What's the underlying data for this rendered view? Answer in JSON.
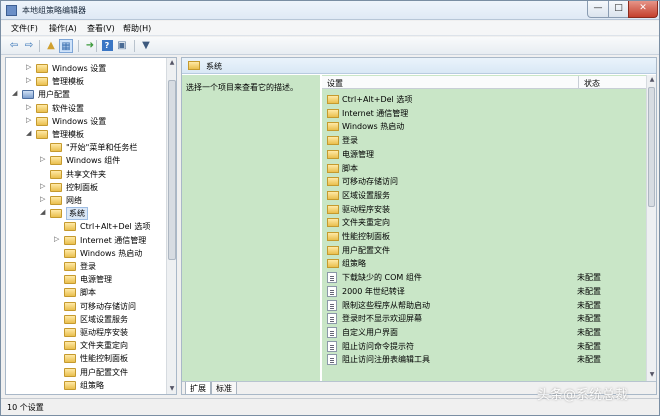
{
  "window": {
    "title": "本地组策略编辑器",
    "controls": {
      "minimize": "—",
      "maximize": "□",
      "close": "✕"
    }
  },
  "menu": [
    {
      "label": "文件(F)"
    },
    {
      "label": "操作(A)"
    },
    {
      "label": "查看(V)"
    },
    {
      "label": "帮助(H)"
    }
  ],
  "toolbar": {
    "icons": [
      "back-arrow-icon",
      "forward-arrow-icon",
      "up-folder-icon",
      "show-tree-icon",
      "export-list-icon",
      "help-icon",
      "properties-icon",
      "filter-icon"
    ],
    "glyphs": {
      "back": "⇦",
      "forward": "⇨",
      "up": "▲",
      "show_tree": "▦",
      "export": "➜",
      "help": "?",
      "properties": "▣",
      "filter": "▼"
    }
  },
  "tree": {
    "toggle_collapsed": "▷",
    "toggle_expanded": "◢",
    "items": [
      {
        "label": "Windows 设置",
        "toggle": "collapsed",
        "icon": "folder"
      },
      {
        "label": "管理模板",
        "toggle": "collapsed",
        "icon": "folder"
      },
      {
        "label": "用户配置",
        "toggle": "expanded",
        "icon": "computer"
      },
      {
        "label": "软件设置",
        "toggle": "collapsed",
        "icon": "folder"
      },
      {
        "label": "Windows 设置",
        "toggle": "collapsed",
        "icon": "folder"
      },
      {
        "label": "管理模板",
        "toggle": "expanded",
        "icon": "folder"
      },
      {
        "label": "\"开始\"菜单和任务栏",
        "toggle": "none",
        "icon": "folder"
      },
      {
        "label": "Windows 组件",
        "toggle": "collapsed",
        "icon": "folder"
      },
      {
        "label": "共享文件夹",
        "toggle": "none",
        "icon": "folder"
      },
      {
        "label": "控制面板",
        "toggle": "collapsed",
        "icon": "folder"
      },
      {
        "label": "网络",
        "toggle": "collapsed",
        "icon": "folder"
      },
      {
        "label": "系统",
        "toggle": "expanded",
        "icon": "folder",
        "selected": true
      },
      {
        "label": "Ctrl+Alt+Del 选项",
        "toggle": "none",
        "icon": "folder"
      },
      {
        "label": "Internet 通信管理",
        "toggle": "collapsed",
        "icon": "folder"
      },
      {
        "label": "Windows 热启动",
        "toggle": "none",
        "icon": "folder"
      },
      {
        "label": "登录",
        "toggle": "none",
        "icon": "folder"
      },
      {
        "label": "电源管理",
        "toggle": "none",
        "icon": "folder"
      },
      {
        "label": "脚本",
        "toggle": "none",
        "icon": "folder"
      },
      {
        "label": "可移动存储访问",
        "toggle": "none",
        "icon": "folder"
      },
      {
        "label": "区域设置服务",
        "toggle": "none",
        "icon": "folder"
      },
      {
        "label": "驱动程序安装",
        "toggle": "none",
        "icon": "folder"
      },
      {
        "label": "文件夹重定向",
        "toggle": "none",
        "icon": "folder"
      },
      {
        "label": "性能控制面板",
        "toggle": "none",
        "icon": "folder"
      },
      {
        "label": "用户配置文件",
        "toggle": "none",
        "icon": "folder"
      },
      {
        "label": "组策略",
        "toggle": "none",
        "icon": "folder"
      }
    ]
  },
  "right": {
    "header_title": "系统",
    "description": "选择一个项目来查看它的描述。",
    "columns": {
      "setting": "设置",
      "state": "状态"
    },
    "rows": [
      {
        "label": "Ctrl+Alt+Del 选项",
        "type": "folder",
        "state": ""
      },
      {
        "label": "Internet 通信管理",
        "type": "folder",
        "state": ""
      },
      {
        "label": "Windows 热启动",
        "type": "folder",
        "state": ""
      },
      {
        "label": "登录",
        "type": "folder",
        "state": ""
      },
      {
        "label": "电源管理",
        "type": "folder",
        "state": ""
      },
      {
        "label": "脚本",
        "type": "folder",
        "state": ""
      },
      {
        "label": "可移动存储访问",
        "type": "folder",
        "state": ""
      },
      {
        "label": "区域设置服务",
        "type": "folder",
        "state": ""
      },
      {
        "label": "驱动程序安装",
        "type": "folder",
        "state": ""
      },
      {
        "label": "文件夹重定向",
        "type": "folder",
        "state": ""
      },
      {
        "label": "性能控制面板",
        "type": "folder",
        "state": ""
      },
      {
        "label": "用户配置文件",
        "type": "folder",
        "state": ""
      },
      {
        "label": "组策略",
        "type": "folder",
        "state": ""
      },
      {
        "label": "下载缺少的 COM 组件",
        "type": "policy",
        "state": "未配置"
      },
      {
        "label": "2000 年世纪转译",
        "type": "policy",
        "state": "未配置"
      },
      {
        "label": "限制这些程序从帮助启动",
        "type": "policy",
        "state": "未配置"
      },
      {
        "label": "登录时不显示欢迎屏幕",
        "type": "policy",
        "state": "未配置"
      },
      {
        "label": "自定义用户界面",
        "type": "policy",
        "state": "未配置"
      },
      {
        "label": "阻止访问命令提示符",
        "type": "policy",
        "state": "未配置"
      },
      {
        "label": "阻止访问注册表编辑工具",
        "type": "policy",
        "state": "未配置"
      }
    ],
    "scroll_up": "▲",
    "scroll_down": "▼"
  },
  "tabs": [
    {
      "label": "扩展",
      "active": true
    },
    {
      "label": "标准",
      "active": false
    }
  ],
  "status": {
    "text": "10 个设置"
  },
  "watermark": "头条@系统总裁"
}
